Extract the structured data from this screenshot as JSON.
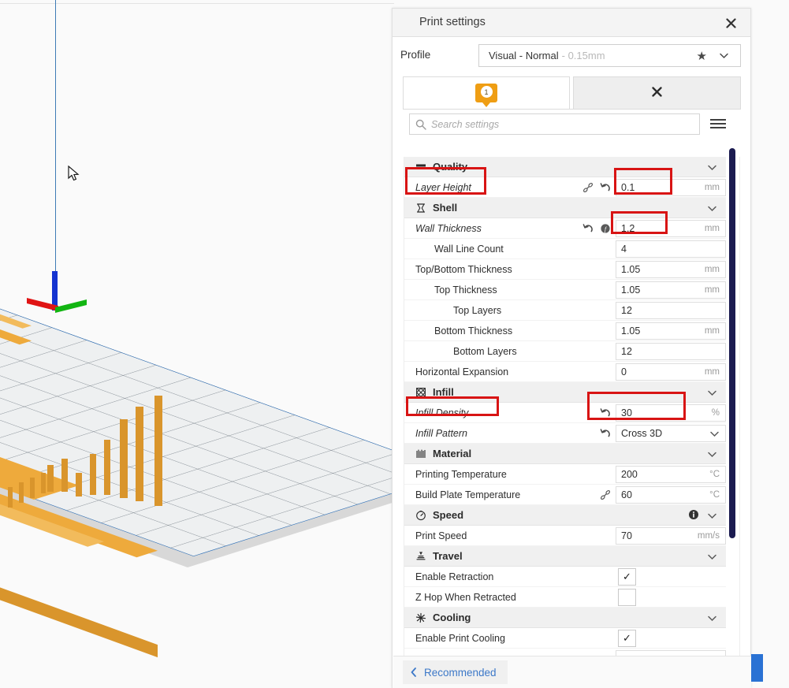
{
  "app": {
    "viewport": {
      "model_color": "#eeaa3c",
      "plate_color": "#eef0f1"
    }
  },
  "panel": {
    "title": "Print settings",
    "close_icon": "close-icon",
    "profile": {
      "label": "Profile",
      "name": "Visual - Normal",
      "sub": "- 0.15mm",
      "star_icon": "star-icon",
      "caret_icon": "chevron-down-icon"
    },
    "tabs": [
      {
        "name": "custom-tab",
        "badge_count": "1"
      },
      {
        "name": "second-tab",
        "icon": "close-icon"
      }
    ],
    "search": {
      "placeholder": "Search settings",
      "icon": "search-icon"
    },
    "menu_icon": "hamburger-menu-icon",
    "bottom": {
      "recommended_label": "Recommended",
      "back_icon": "chevron-left-icon"
    }
  },
  "sections": [
    {
      "name": "quality",
      "title": "Quality",
      "icon": "quality-layers-icon",
      "rows": [
        {
          "name": "layer-height",
          "label": "Layer Height",
          "italic": true,
          "indent": 0,
          "icons": [
            "link-icon",
            "revert-icon"
          ],
          "value": "0.1",
          "unit": "mm",
          "type": "text"
        }
      ]
    },
    {
      "name": "shell",
      "title": "Shell",
      "icon": "shell-icon",
      "rows": [
        {
          "name": "wall-thickness",
          "label": "Wall Thickness",
          "italic": true,
          "indent": 0,
          "icons": [
            "revert-icon",
            "function-icon"
          ],
          "value": "1.2",
          "unit": "mm",
          "type": "text"
        },
        {
          "name": "wall-line-count",
          "label": "Wall Line Count",
          "italic": false,
          "indent": 1,
          "icons": [],
          "value": "4",
          "unit": "",
          "type": "text"
        },
        {
          "name": "top-bottom-thickness",
          "label": "Top/Bottom Thickness",
          "italic": false,
          "indent": 0,
          "icons": [],
          "value": "1.05",
          "unit": "mm",
          "type": "text"
        },
        {
          "name": "top-thickness",
          "label": "Top Thickness",
          "italic": false,
          "indent": 1,
          "icons": [],
          "value": "1.05",
          "unit": "mm",
          "type": "text"
        },
        {
          "name": "top-layers",
          "label": "Top Layers",
          "italic": false,
          "indent": 2,
          "icons": [],
          "value": "12",
          "unit": "",
          "type": "text"
        },
        {
          "name": "bottom-thickness",
          "label": "Bottom Thickness",
          "italic": false,
          "indent": 1,
          "icons": [],
          "value": "1.05",
          "unit": "mm",
          "type": "text"
        },
        {
          "name": "bottom-layers",
          "label": "Bottom Layers",
          "italic": false,
          "indent": 2,
          "icons": [],
          "value": "12",
          "unit": "",
          "type": "text"
        },
        {
          "name": "horizontal-expansion",
          "label": "Horizontal Expansion",
          "italic": false,
          "indent": 0,
          "icons": [],
          "value": "0",
          "unit": "mm",
          "type": "text"
        }
      ]
    },
    {
      "name": "infill",
      "title": "Infill",
      "icon": "infill-icon",
      "rows": [
        {
          "name": "infill-density",
          "label": "Infill Density",
          "italic": true,
          "indent": 0,
          "icons": [
            "revert-icon"
          ],
          "value": "30",
          "unit": "%",
          "type": "text"
        },
        {
          "name": "infill-pattern",
          "label": "Infill Pattern",
          "italic": true,
          "indent": 0,
          "icons": [
            "revert-icon"
          ],
          "value": "Cross 3D",
          "unit": "",
          "type": "select"
        }
      ]
    },
    {
      "name": "material",
      "title": "Material",
      "icon": "material-icon",
      "rows": [
        {
          "name": "printing-temperature",
          "label": "Printing Temperature",
          "italic": false,
          "indent": 0,
          "icons": [],
          "value": "200",
          "unit": "°C",
          "type": "text"
        },
        {
          "name": "build-plate-temperature",
          "label": "Build Plate Temperature",
          "italic": false,
          "indent": 0,
          "icons": [
            "link-icon"
          ],
          "value": "60",
          "unit": "°C",
          "type": "text"
        }
      ]
    },
    {
      "name": "speed",
      "title": "Speed",
      "icon": "speed-icon",
      "header_info": "info-icon",
      "rows": [
        {
          "name": "print-speed",
          "label": "Print Speed",
          "italic": false,
          "indent": 0,
          "icons": [],
          "value": "70",
          "unit": "mm/s",
          "type": "text"
        }
      ]
    },
    {
      "name": "travel",
      "title": "Travel",
      "icon": "travel-icon",
      "rows": [
        {
          "name": "enable-retraction",
          "label": "Enable Retraction",
          "italic": false,
          "indent": 0,
          "icons": [],
          "value": "",
          "unit": "",
          "type": "checkbox",
          "checked": true
        },
        {
          "name": "z-hop-when-retracted",
          "label": "Z Hop When Retracted",
          "italic": false,
          "indent": 0,
          "icons": [],
          "value": "",
          "unit": "",
          "type": "checkbox",
          "checked": false
        }
      ]
    },
    {
      "name": "cooling",
      "title": "Cooling",
      "icon": "cooling-fan-icon",
      "rows": [
        {
          "name": "enable-print-cooling",
          "label": "Enable Print Cooling",
          "italic": false,
          "indent": 0,
          "icons": [],
          "value": "",
          "unit": "",
          "type": "checkbox",
          "checked": true
        },
        {
          "name": "cooling-extra-row",
          "label": "",
          "italic": false,
          "indent": 0,
          "icons": [],
          "value": "",
          "unit": "",
          "type": "text"
        }
      ]
    }
  ],
  "annotations": {
    "color": "#d81414",
    "boxes": [
      "layer-height-label",
      "layer-height-value",
      "wall-thickness-value",
      "infill-density-label",
      "infill-density-value"
    ]
  }
}
